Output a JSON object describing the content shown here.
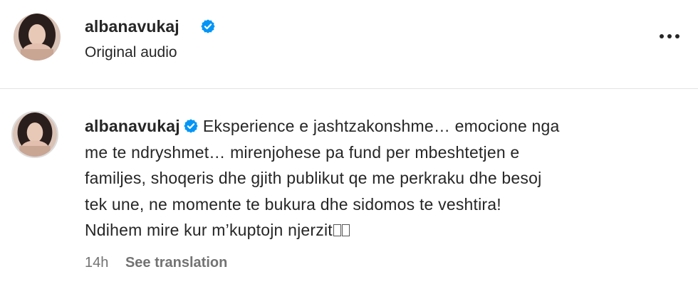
{
  "post": {
    "author": "albanavukaj",
    "verified": true,
    "audio_label": "Original audio",
    "more_icon": "more-horizontal-icon"
  },
  "caption": {
    "author": "albanavukaj",
    "lines": [
      "Eksperience e jashtzakonshme… emocione nga",
      "me te ndryshmet… mirenjohese pa fund per mbeshtetjen e",
      "familjes, shoqeris dhe gjith publikut qe me perkraku dhe besoj",
      "tek une, ne momente te bukura dhe sidomos te veshtira!",
      "Ndihem mire kur m’kuptojn njerzit"
    ],
    "trailing_glyphs": 2
  },
  "meta": {
    "time": "14h",
    "see_translation": "See translation"
  },
  "colors": {
    "verified_badge": "#0095f6",
    "text_primary": "#262626",
    "text_secondary": "#737373",
    "divider": "#e3e3e3"
  }
}
